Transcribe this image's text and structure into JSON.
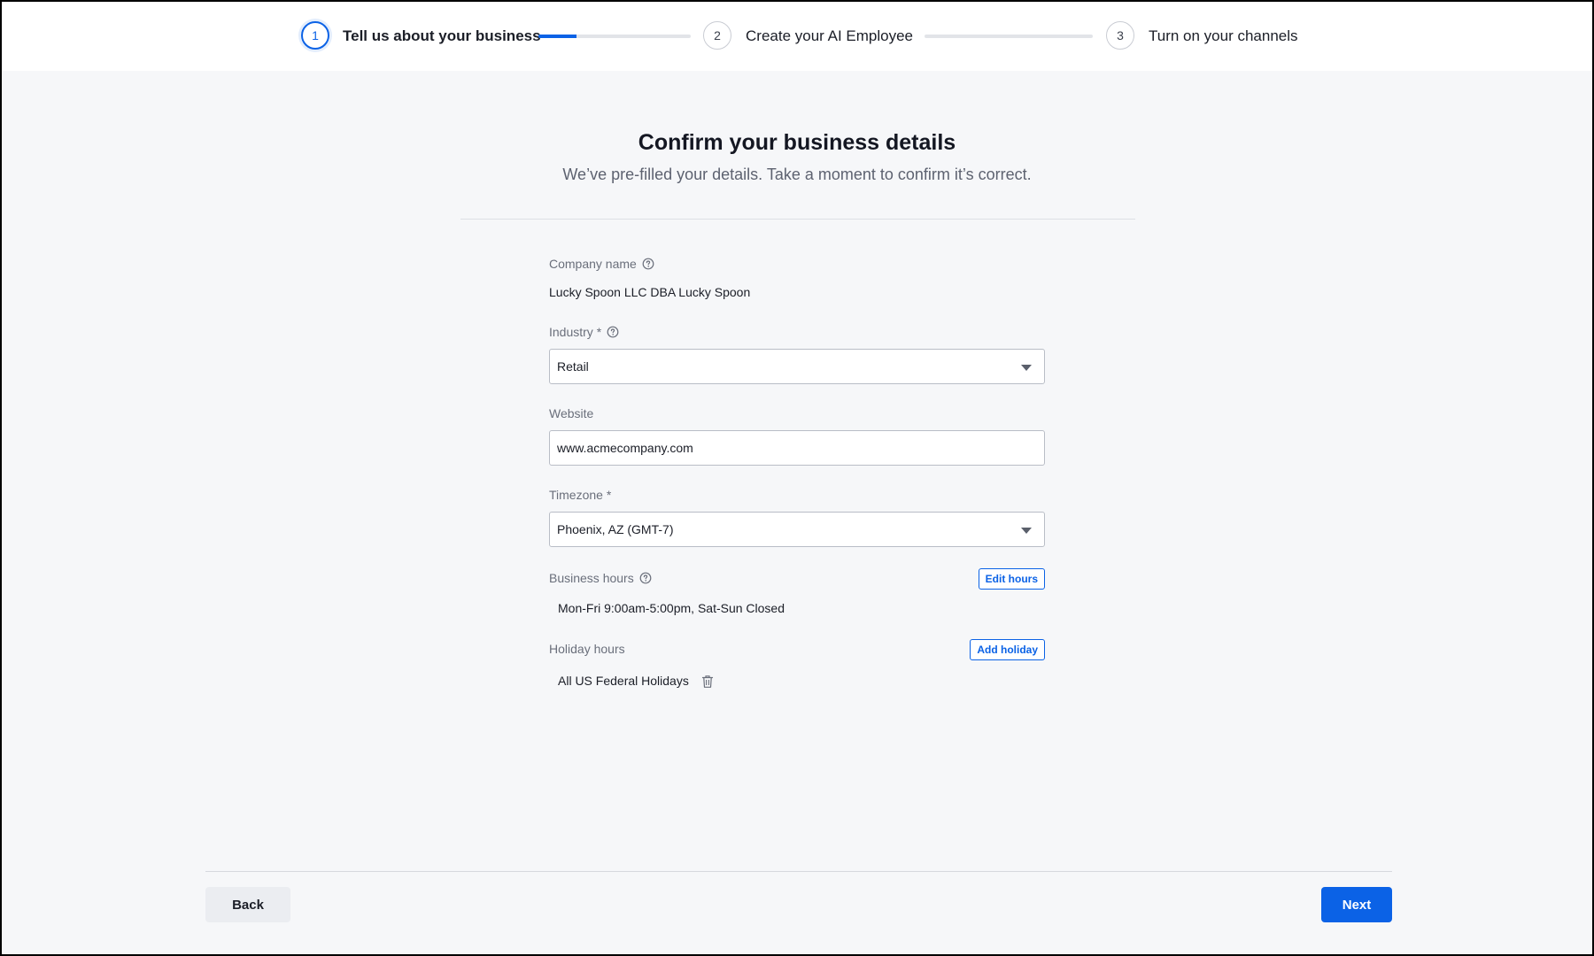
{
  "stepper": {
    "steps": [
      {
        "number": "1",
        "label": "Tell us about your business",
        "state": "active"
      },
      {
        "number": "2",
        "label": "Create your AI Employee",
        "state": "upcoming"
      },
      {
        "number": "3",
        "label": "Turn on your channels",
        "state": "upcoming"
      }
    ],
    "progress": [
      0.25,
      0,
      0
    ]
  },
  "header": {
    "title": "Confirm your business details",
    "subtitle": "We’ve pre-filled your details. Take a moment to confirm it’s correct."
  },
  "form": {
    "company_name": {
      "label": "Company name",
      "value": "Lucky Spoon LLC DBA Lucky Spoon"
    },
    "industry": {
      "label": "Industry *",
      "value": "Retail"
    },
    "website": {
      "label": "Website",
      "value": "www.acmecompany.com"
    },
    "timezone": {
      "label": "Timezone *",
      "value": "Phoenix, AZ (GMT-7)"
    },
    "business_hours": {
      "label": "Business hours",
      "value": "Mon-Fri 9:00am-5:00pm, Sat-Sun Closed",
      "button": "Edit hours"
    },
    "holiday_hours": {
      "label": "Holiday hours",
      "value": "All US Federal Holidays",
      "button": "Add holiday"
    }
  },
  "footer": {
    "back_label": "Back",
    "next_label": "Next"
  },
  "colors": {
    "accent": "#0b62e6",
    "background": "#f6f7f9"
  }
}
